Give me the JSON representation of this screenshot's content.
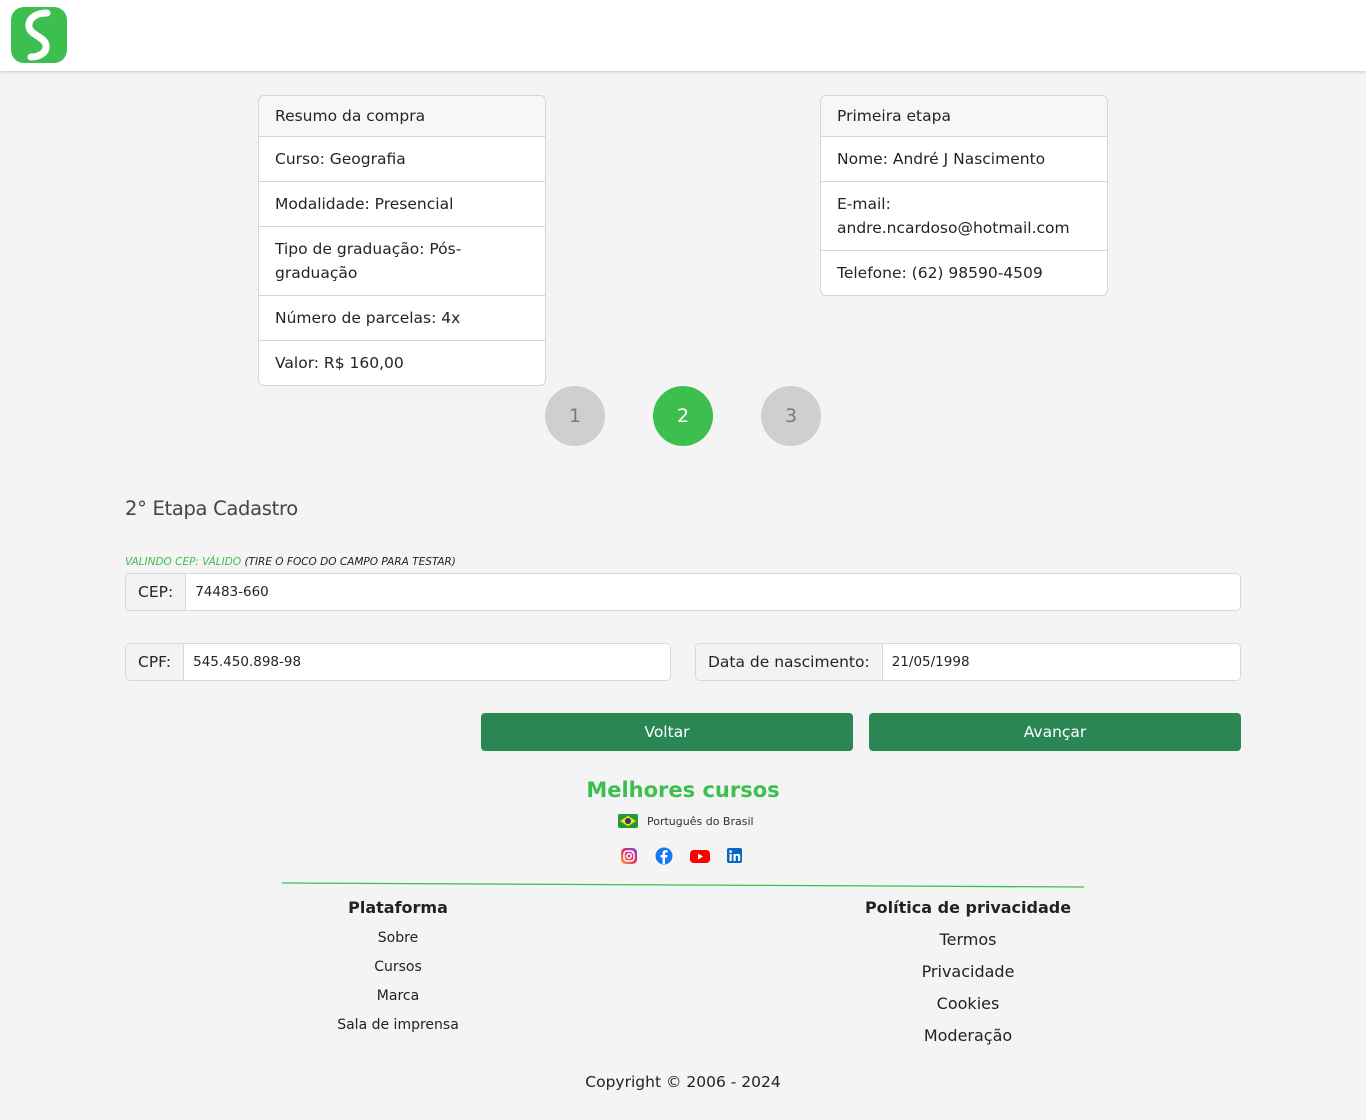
{
  "summary_card": {
    "title": "Resumo da compra",
    "items": [
      "Curso: Geografia",
      "Modalidade: Presencial",
      "Tipo de graduação: Pós-graduação",
      "Número de parcelas: 4x",
      "Valor: R$ 160,00"
    ]
  },
  "first_step_card": {
    "title": "Primeira etapa",
    "items": [
      "Nome: André J Nascimento",
      "E-mail: andre.ncardoso@hotmail.com",
      "Telefone: (62) 98590-4509"
    ]
  },
  "stepper": {
    "steps": [
      "1",
      "2",
      "3"
    ],
    "active_step": 2
  },
  "form": {
    "title": "2° Etapa Cadastro",
    "cep_status": "Valindo CEP: Válido",
    "cep_hint": "(Tire o foco do campo para testar)",
    "cep": {
      "label": "CEP:",
      "value": "74483-660"
    },
    "cpf": {
      "label": "CPF:",
      "value": "545.450.898-98"
    },
    "birth_date": {
      "label": "Data de nascimento:",
      "value": "21/05/1998"
    },
    "back_button": "Voltar",
    "next_button": "Avançar"
  },
  "footer": {
    "brand": "Melhores cursos",
    "language": "Português do Brasil",
    "social_icons": [
      "instagram-icon",
      "facebook-icon",
      "youtube-icon",
      "linkedin-icon"
    ],
    "platform": {
      "title": "Plataforma",
      "links": [
        "Sobre",
        "Cursos",
        "Marca",
        "Sala de imprensa"
      ]
    },
    "privacy": {
      "title": "Política de privacidade",
      "links": [
        "Termos",
        "Privacidade",
        "Cookies",
        "Moderação"
      ]
    },
    "copyright": "Copyright © 2006 - 2024"
  },
  "colors": {
    "brand_green": "#3cbf4e",
    "button_green": "#2a8754",
    "step_inactive": "#cfcfcf"
  }
}
